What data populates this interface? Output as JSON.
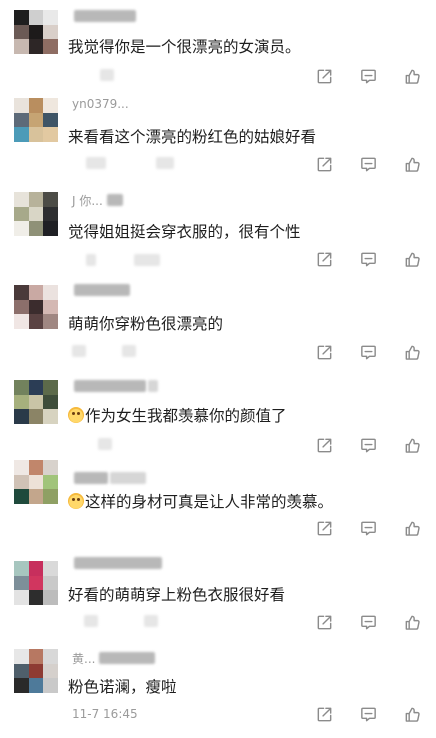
{
  "comments": [
    {
      "username": "",
      "text": "我觉得你是一个很漂亮的女演员。",
      "emoji": false,
      "timestamp": "",
      "avatar_colors": [
        "#1f1f1f",
        "#cfcfcf",
        "#e9e9e9",
        "#6b5a55",
        "#1d1a1a",
        "#d9cfc9",
        "#c7b8b0",
        "#2d2626",
        "#8e6d63"
      ]
    },
    {
      "username": "yn0379...",
      "text": "来看看这个漂亮的粉红色的姑娘好看",
      "emoji": false,
      "timestamp": "",
      "avatar_colors": [
        "#e9e3dc",
        "#b98e5f",
        "#efe7de",
        "#5d6a78",
        "#c6a473",
        "#3f5566",
        "#4c9bb8",
        "#d8c29b",
        "#e2c9a1"
      ]
    },
    {
      "username": "J 你...",
      "text": "觉得姐姐挺会穿衣服的，很有个性",
      "emoji": false,
      "timestamp": "",
      "avatar_colors": [
        "#e7e3da",
        "#b7b29a",
        "#4c4c46",
        "#a7a98a",
        "#d9d6c6",
        "#2d2e30",
        "#f0eee8",
        "#8f9177",
        "#1f2024"
      ]
    },
    {
      "username": "",
      "text": "萌萌你穿粉色很漂亮的",
      "emoji": false,
      "timestamp": "",
      "avatar_colors": [
        "#4a3a3a",
        "#c9a9a3",
        "#ebe2df",
        "#8c6f6b",
        "#3b2c2d",
        "#d4b8b3",
        "#f0e6e4",
        "#5a4242",
        "#a08782"
      ]
    },
    {
      "username": "",
      "text": "作为女生我都羡慕你的颜值了",
      "emoji": true,
      "timestamp": "",
      "avatar_colors": [
        "#72825d",
        "#2b3d55",
        "#5c6a4a",
        "#a6b07d",
        "#c9c4a6",
        "#3e4d3a",
        "#2a3a49",
        "#8b8466",
        "#d7d3c0"
      ]
    },
    {
      "username": "",
      "text": "这样的身材可真是让人非常的羡慕。",
      "emoji": true,
      "timestamp": "",
      "avatar_colors": [
        "#efe8e4",
        "#c1866b",
        "#d8d2cc",
        "#d0c2b6",
        "#ede1d7",
        "#a1c47a",
        "#1f4a3c",
        "#c3a68c",
        "#8fa064"
      ]
    },
    {
      "username": "",
      "text": "好看的萌萌穿上粉色衣服很好看",
      "emoji": false,
      "timestamp": "",
      "avatar_colors": [
        "#a7c6bf",
        "#c72f5d",
        "#d9d9d9",
        "#7d8f99",
        "#d1365f",
        "#c9c9c9",
        "#e3e3e3",
        "#2d2d2d",
        "#bcbcbc"
      ]
    },
    {
      "username": "黄...",
      "text": "粉色诺澜，瘦啦",
      "emoji": false,
      "timestamp": "11-7 16:45",
      "avatar_colors": [
        "#e7e7e7",
        "#b77862",
        "#d8d8d8",
        "#4f5f6b",
        "#8e3b33",
        "#d5d0cc",
        "#2a2a2a",
        "#4e7a9a",
        "#c9c9c9"
      ]
    }
  ]
}
